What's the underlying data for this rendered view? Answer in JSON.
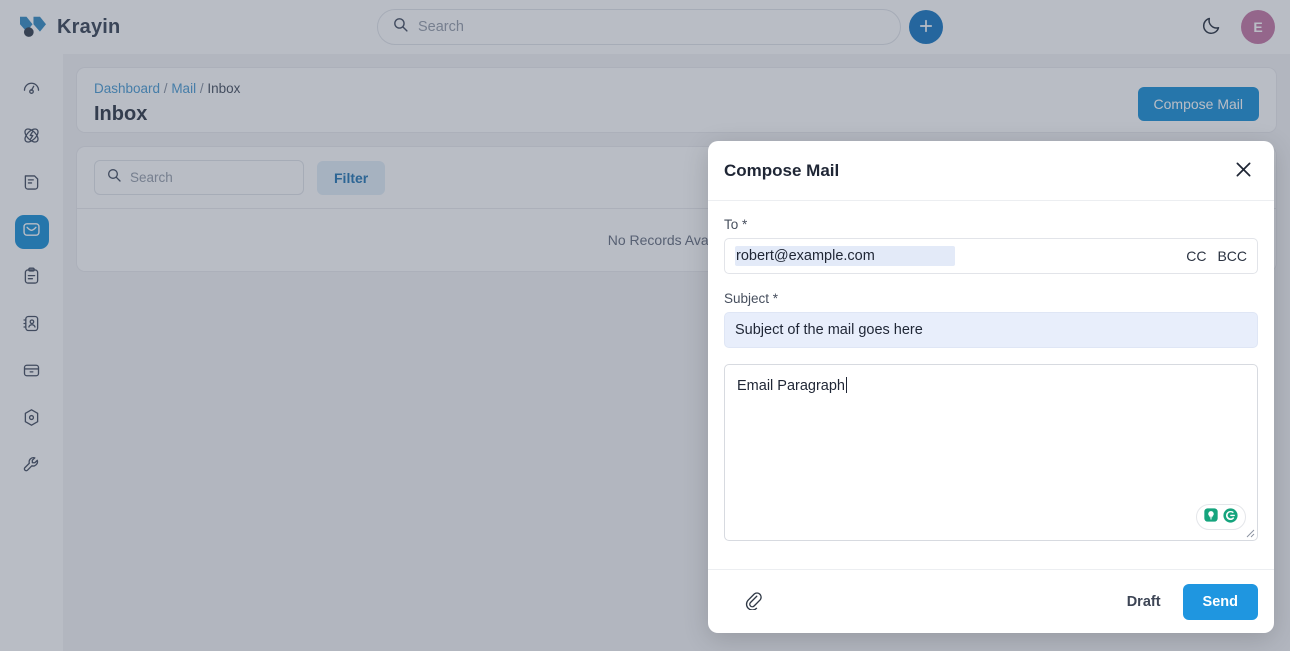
{
  "header": {
    "brand_name": "Krayin",
    "search_placeholder": "Search",
    "search_value": "",
    "add_icon": "plus-icon",
    "theme_icon": "moon-icon",
    "avatar_initial": "E"
  },
  "sidebar": {
    "items": [
      {
        "name": "dashboard",
        "icon": "gauge-icon",
        "active": false
      },
      {
        "name": "leads",
        "icon": "atom-icon",
        "active": false
      },
      {
        "name": "quotes",
        "icon": "document-icon",
        "active": false
      },
      {
        "name": "mail",
        "icon": "envelope-icon",
        "active": true
      },
      {
        "name": "activities",
        "icon": "clipboard-icon",
        "active": false
      },
      {
        "name": "contacts",
        "icon": "contact-card-icon",
        "active": false
      },
      {
        "name": "products",
        "icon": "box-icon",
        "active": false
      },
      {
        "name": "campaigns",
        "icon": "hexagon-target-icon",
        "active": false
      },
      {
        "name": "settings",
        "icon": "wrench-icon",
        "active": false
      }
    ]
  },
  "page": {
    "breadcrumb": {
      "dashboard": "Dashboard",
      "mail": "Mail",
      "current": "Inbox",
      "separator": "/"
    },
    "title": "Inbox",
    "compose_button": "Compose Mail",
    "list_search_placeholder": "Search",
    "list_search_value": "",
    "filter_button": "Filter",
    "empty_message": "No Records Available."
  },
  "modal": {
    "title": "Compose Mail",
    "close_icon": "close-icon",
    "to_label": "To *",
    "to_value": "robert@example.com",
    "cc_label": "CC",
    "bcc_label": "BCC",
    "subject_label": "Subject *",
    "subject_value": "Subject of the mail goes here",
    "body_value": "Email Paragraph",
    "grammarly_icons": [
      "lightbulb-icon",
      "grammarly-g-icon"
    ],
    "attach_icon": "paperclip-icon",
    "draft_button": "Draft",
    "send_button": "Send"
  },
  "colors": {
    "brand_blue": "#2194d8",
    "send_blue": "#1f96e0",
    "avatar_pink": "#c77ca8",
    "filter_bg": "#e3eef7",
    "autofill_blue": "#e8eefb",
    "grammarly_green": "#15a47d"
  }
}
